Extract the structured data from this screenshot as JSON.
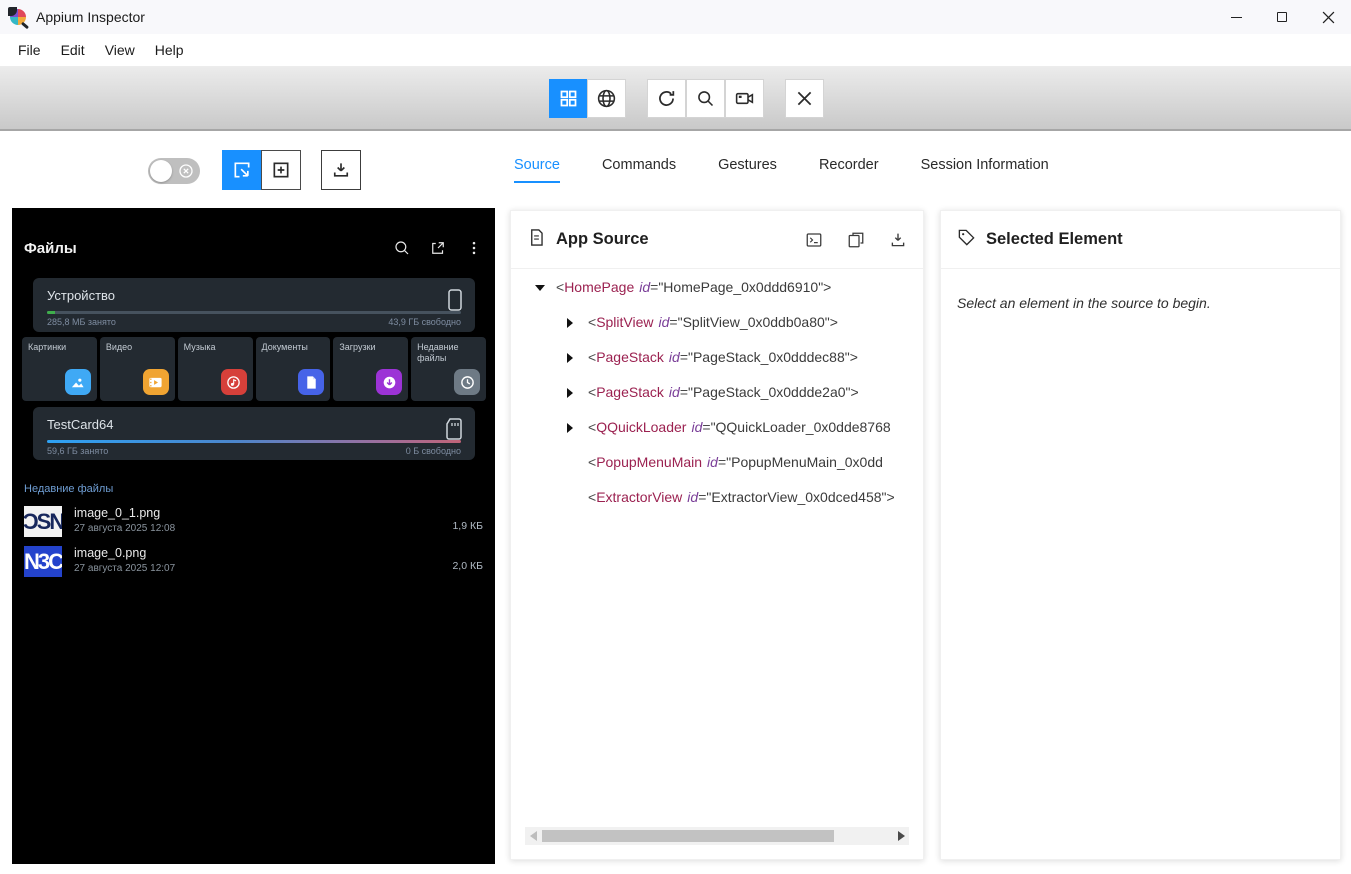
{
  "window": {
    "title": "Appium Inspector"
  },
  "menu": {
    "items": [
      "File",
      "Edit",
      "View",
      "Help"
    ]
  },
  "toolbar": {
    "buttons": [
      "grid-overlay",
      "web-view",
      "refresh-source",
      "search-elements",
      "start-recording",
      "quit-session"
    ],
    "active_button": "grid-overlay"
  },
  "screenshot_controls": {
    "toggle_state": "off",
    "buttons": [
      "select-elements-mode",
      "swipe-tap-mode",
      "download-screenshot"
    ],
    "active_button": "select-elements-mode"
  },
  "tabs": {
    "items": [
      "Source",
      "Commands",
      "Gestures",
      "Recorder",
      "Session Information"
    ],
    "active": "Source"
  },
  "colors": {
    "accent": "#1890ff",
    "tag_name": "#9b2150",
    "attr_name": "#7a3e98",
    "device_card": "#232a31",
    "used_green": "#3fae4c"
  },
  "device_screen": {
    "app_title": "Файлы",
    "header_icons": [
      "search",
      "open-in-new",
      "more-menu"
    ],
    "storage": [
      {
        "title": "Устройство",
        "used": "285,8 МБ занято",
        "free": "43,9 ГБ свободно"
      },
      {
        "title": "TestCard64",
        "used": "59,6 ГБ занято",
        "free": "0 Б свободно"
      }
    ],
    "categories": [
      {
        "label": "Картинки",
        "icon": "pictures-icon",
        "color": "#3fa9f5"
      },
      {
        "label": "Видео",
        "icon": "video-icon",
        "color": "#f0a432"
      },
      {
        "label": "Музыка",
        "icon": "music-icon",
        "color": "#d6403a"
      },
      {
        "label": "Документы",
        "icon": "documents-icon",
        "color": "#4663e8"
      },
      {
        "label": "Загрузки",
        "icon": "downloads-icon",
        "color": "#9c33d6"
      },
      {
        "label": "Недавние файлы",
        "icon": "recent-icon",
        "color": "#6e7a85"
      }
    ],
    "recent": {
      "header": "Недавние файлы",
      "files": [
        {
          "name": "image_0_1.png",
          "date": "27 августа 2025 12:08",
          "size": "1,9 КБ",
          "thumb_text": "ƆSN"
        },
        {
          "name": "image_0.png",
          "date": "27 августа 2025 12:07",
          "size": "2,0 КБ",
          "thumb_text": "N3C"
        }
      ]
    }
  },
  "source_panel": {
    "title": "App Source",
    "actions": [
      "toggle-xpath-console",
      "copy-source",
      "download-source"
    ],
    "syntax": {
      "lt": "<",
      "eq": "="
    },
    "tree": [
      {
        "tag": "HomePage",
        "attr": "id",
        "value": "\"HomePage_0x0ddd6910\">"
      },
      {
        "tag": "SplitView",
        "attr": "id",
        "value": "\"SplitView_0x0ddb0a80\">"
      },
      {
        "tag": "PageStack",
        "attr": "id",
        "value": "\"PageStack_0x0dddec88\">"
      },
      {
        "tag": "PageStack",
        "attr": "id",
        "value": "\"PageStack_0x0ddde2a0\">"
      },
      {
        "tag": "QQuickLoader",
        "attr": "id",
        "value": "\"QQuickLoader_0x0dde8768"
      },
      {
        "tag": "PopupMenuMain",
        "attr": "id",
        "value": "\"PopupMenuMain_0x0dd"
      },
      {
        "tag": "ExtractorView",
        "attr": "id",
        "value": "\"ExtractorView_0x0dced458\">"
      }
    ]
  },
  "selected_panel": {
    "title": "Selected Element",
    "empty_message": "Select an element in the source to begin."
  }
}
